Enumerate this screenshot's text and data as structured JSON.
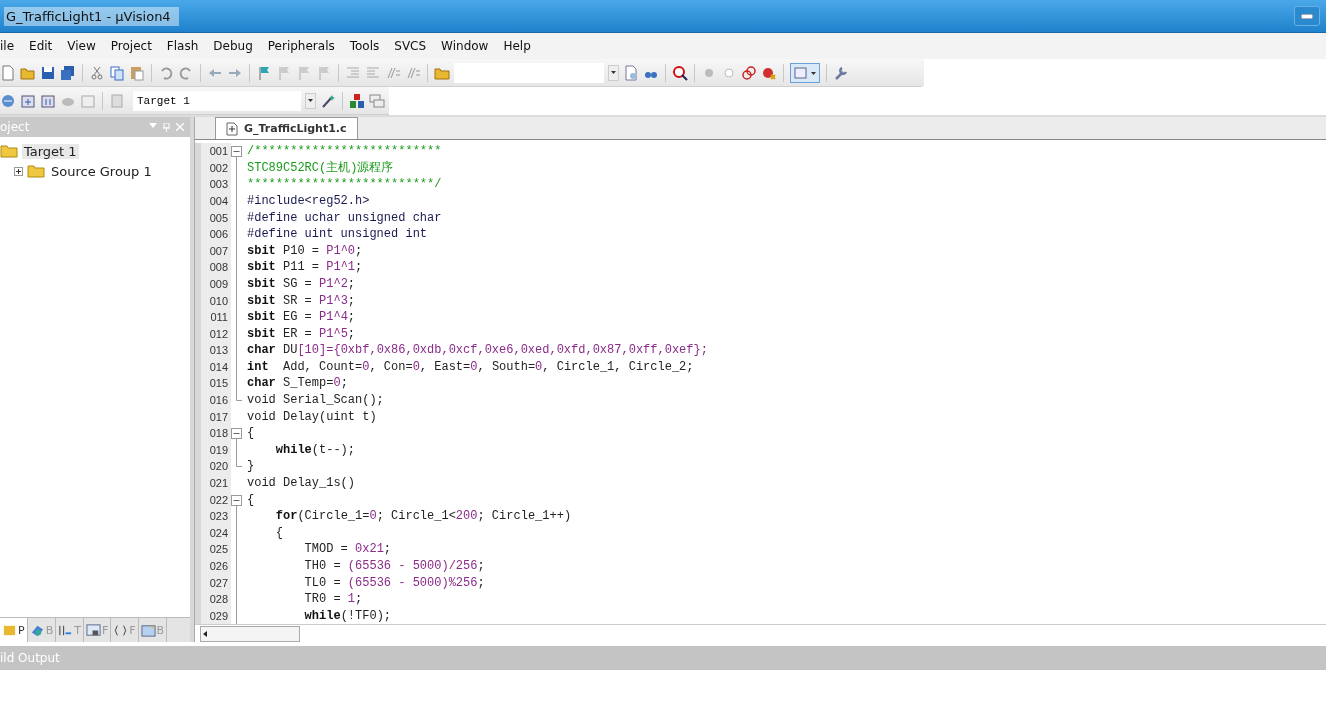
{
  "window": {
    "title": "G_TrafficLight1  - µVision4"
  },
  "menu": [
    {
      "label": "ile"
    },
    {
      "label": "Edit"
    },
    {
      "label": "View"
    },
    {
      "label": "Project"
    },
    {
      "label": "Flash"
    },
    {
      "label": "Debug"
    },
    {
      "label": "Peripherals"
    },
    {
      "label": "Tools"
    },
    {
      "label": "SVCS"
    },
    {
      "label": "Window"
    },
    {
      "label": "Help"
    }
  ],
  "target_select": {
    "value": "Target 1"
  },
  "project_panel": {
    "title": "oject",
    "tree": [
      {
        "label": "Target 1",
        "selected": true,
        "children": [
          {
            "label": "Source Group 1",
            "selected": false,
            "expanded": false
          }
        ]
      }
    ],
    "tabs": [
      {
        "label": "P",
        "selected": true
      },
      {
        "label": "B",
        "selected": false
      },
      {
        "label": "T",
        "selected": false
      },
      {
        "label": "F",
        "selected": false
      },
      {
        "label": "F",
        "selected": false
      },
      {
        "label": "B",
        "selected": false
      }
    ]
  },
  "editor": {
    "tabs": [
      {
        "label": "G_TrafficLight1.c",
        "selected": true
      }
    ],
    "lines": [
      {
        "number": "001",
        "fold_start": true,
        "fold_end": false,
        "segments": [
          {
            "kind": "cmt",
            "text": "/**************************"
          }
        ]
      },
      {
        "number": "002",
        "fold_start": false,
        "fold_end": false,
        "segments": [
          {
            "kind": "cmt",
            "text": "STC89C52RC(主机)源程序"
          }
        ]
      },
      {
        "number": "003",
        "fold_start": false,
        "fold_end": false,
        "segments": [
          {
            "kind": "cmt",
            "text": "**************************/"
          }
        ]
      },
      {
        "number": "004",
        "fold_start": false,
        "fold_end": false,
        "segments": [
          {
            "kind": "pp",
            "text": "#include<reg52.h>"
          }
        ]
      },
      {
        "number": "005",
        "fold_start": false,
        "fold_end": false,
        "segments": [
          {
            "kind": "pp",
            "text": "#define uchar unsigned char"
          }
        ]
      },
      {
        "number": "006",
        "fold_start": false,
        "fold_end": false,
        "segments": [
          {
            "kind": "pp",
            "text": "#define uint unsigned int"
          }
        ]
      },
      {
        "number": "007",
        "fold_start": false,
        "fold_end": false,
        "segments": [
          {
            "kind": "kw",
            "text": "sbit"
          },
          {
            "kind": "txt",
            "text": " P10 = "
          },
          {
            "kind": "num",
            "text": "P1^0"
          },
          {
            "kind": "txt",
            "text": ";"
          }
        ]
      },
      {
        "number": "008",
        "fold_start": false,
        "fold_end": false,
        "segments": [
          {
            "kind": "kw",
            "text": "sbit"
          },
          {
            "kind": "txt",
            "text": " P11 = "
          },
          {
            "kind": "num",
            "text": "P1^1"
          },
          {
            "kind": "txt",
            "text": ";"
          }
        ]
      },
      {
        "number": "009",
        "fold_start": false,
        "fold_end": false,
        "segments": [
          {
            "kind": "kw",
            "text": "sbit"
          },
          {
            "kind": "txt",
            "text": " SG = "
          },
          {
            "kind": "num",
            "text": "P1^2"
          },
          {
            "kind": "txt",
            "text": ";"
          }
        ]
      },
      {
        "number": "010",
        "fold_start": false,
        "fold_end": false,
        "segments": [
          {
            "kind": "kw",
            "text": "sbit"
          },
          {
            "kind": "txt",
            "text": " SR = "
          },
          {
            "kind": "num",
            "text": "P1^3"
          },
          {
            "kind": "txt",
            "text": ";"
          }
        ]
      },
      {
        "number": "011",
        "fold_start": false,
        "fold_end": false,
        "segments": [
          {
            "kind": "kw",
            "text": "sbit"
          },
          {
            "kind": "txt",
            "text": " EG = "
          },
          {
            "kind": "num",
            "text": "P1^4"
          },
          {
            "kind": "txt",
            "text": ";"
          }
        ]
      },
      {
        "number": "012",
        "fold_start": false,
        "fold_end": false,
        "segments": [
          {
            "kind": "kw",
            "text": "sbit"
          },
          {
            "kind": "txt",
            "text": " ER = "
          },
          {
            "kind": "num",
            "text": "P1^5"
          },
          {
            "kind": "txt",
            "text": ";"
          }
        ]
      },
      {
        "number": "013",
        "fold_start": false,
        "fold_end": false,
        "segments": [
          {
            "kind": "kw",
            "text": "char"
          },
          {
            "kind": "txt",
            "text": " DU"
          },
          {
            "kind": "num",
            "text": "[10]={0xbf,0x86,0xdb,0xcf,0xe6,0xed,0xfd,0x87,0xff,0xef};"
          }
        ]
      },
      {
        "number": "014",
        "fold_start": false,
        "fold_end": false,
        "segments": [
          {
            "kind": "kw",
            "text": "int"
          },
          {
            "kind": "txt",
            "text": "  Add, Count="
          },
          {
            "kind": "num",
            "text": "0"
          },
          {
            "kind": "txt",
            "text": ", Con="
          },
          {
            "kind": "num",
            "text": "0"
          },
          {
            "kind": "txt",
            "text": ", East="
          },
          {
            "kind": "num",
            "text": "0"
          },
          {
            "kind": "txt",
            "text": ", South="
          },
          {
            "kind": "num",
            "text": "0"
          },
          {
            "kind": "txt",
            "text": ", Circle_1, Circle_2;"
          }
        ]
      },
      {
        "number": "015",
        "fold_start": false,
        "fold_end": false,
        "segments": [
          {
            "kind": "kw",
            "text": "char"
          },
          {
            "kind": "txt",
            "text": " S_Temp="
          },
          {
            "kind": "num",
            "text": "0"
          },
          {
            "kind": "txt",
            "text": ";"
          }
        ]
      },
      {
        "number": "016",
        "fold_start": false,
        "fold_end": true,
        "segments": [
          {
            "kind": "txt",
            "text": "void Serial_Scan();"
          }
        ]
      },
      {
        "number": "017",
        "fold_start": false,
        "fold_end": false,
        "segments": [
          {
            "kind": "txt",
            "text": "void Delay(uint t)"
          }
        ]
      },
      {
        "number": "018",
        "fold_start": true,
        "fold_end": false,
        "segments": [
          {
            "kind": "txt",
            "text": "{"
          }
        ]
      },
      {
        "number": "019",
        "fold_start": false,
        "fold_end": false,
        "segments": [
          {
            "kind": "kw",
            "text": "    while"
          },
          {
            "kind": "txt",
            "text": "(t--);"
          }
        ]
      },
      {
        "number": "020",
        "fold_start": false,
        "fold_end": true,
        "segments": [
          {
            "kind": "txt",
            "text": "}"
          }
        ]
      },
      {
        "number": "021",
        "fold_start": false,
        "fold_end": false,
        "segments": [
          {
            "kind": "txt",
            "text": "void Delay_1s()"
          }
        ]
      },
      {
        "number": "022",
        "fold_start": true,
        "fold_end": false,
        "segments": [
          {
            "kind": "txt",
            "text": "{"
          }
        ]
      },
      {
        "number": "023",
        "fold_start": false,
        "fold_end": false,
        "segments": [
          {
            "kind": "kw",
            "text": "    for"
          },
          {
            "kind": "txt",
            "text": "(Circle_1="
          },
          {
            "kind": "num",
            "text": "0"
          },
          {
            "kind": "txt",
            "text": "; Circle_1<"
          },
          {
            "kind": "num",
            "text": "200"
          },
          {
            "kind": "txt",
            "text": "; Circle_1++)"
          }
        ]
      },
      {
        "number": "024",
        "fold_start": false,
        "fold_end": false,
        "segments": [
          {
            "kind": "txt",
            "text": "    {"
          }
        ]
      },
      {
        "number": "025",
        "fold_start": false,
        "fold_end": false,
        "segments": [
          {
            "kind": "txt",
            "text": "        TMOD = "
          },
          {
            "kind": "num",
            "text": "0x21"
          },
          {
            "kind": "txt",
            "text": ";"
          }
        ]
      },
      {
        "number": "026",
        "fold_start": false,
        "fold_end": false,
        "segments": [
          {
            "kind": "txt",
            "text": "        TH0 = "
          },
          {
            "kind": "num",
            "text": "(65536 - 5000)/256"
          },
          {
            "kind": "txt",
            "text": ";"
          }
        ]
      },
      {
        "number": "027",
        "fold_start": false,
        "fold_end": false,
        "segments": [
          {
            "kind": "txt",
            "text": "        TL0 = "
          },
          {
            "kind": "num",
            "text": "(65536 - 5000)%256"
          },
          {
            "kind": "txt",
            "text": ";"
          }
        ]
      },
      {
        "number": "028",
        "fold_start": false,
        "fold_end": false,
        "segments": [
          {
            "kind": "txt",
            "text": "        TR0 = "
          },
          {
            "kind": "num",
            "text": "1"
          },
          {
            "kind": "txt",
            "text": ";"
          }
        ]
      },
      {
        "number": "029",
        "fold_start": false,
        "fold_end": false,
        "segments": [
          {
            "kind": "kw",
            "text": "        while"
          },
          {
            "kind": "txt",
            "text": "(!TF0);"
          }
        ]
      }
    ]
  },
  "build_output": {
    "title": "ild Output"
  }
}
